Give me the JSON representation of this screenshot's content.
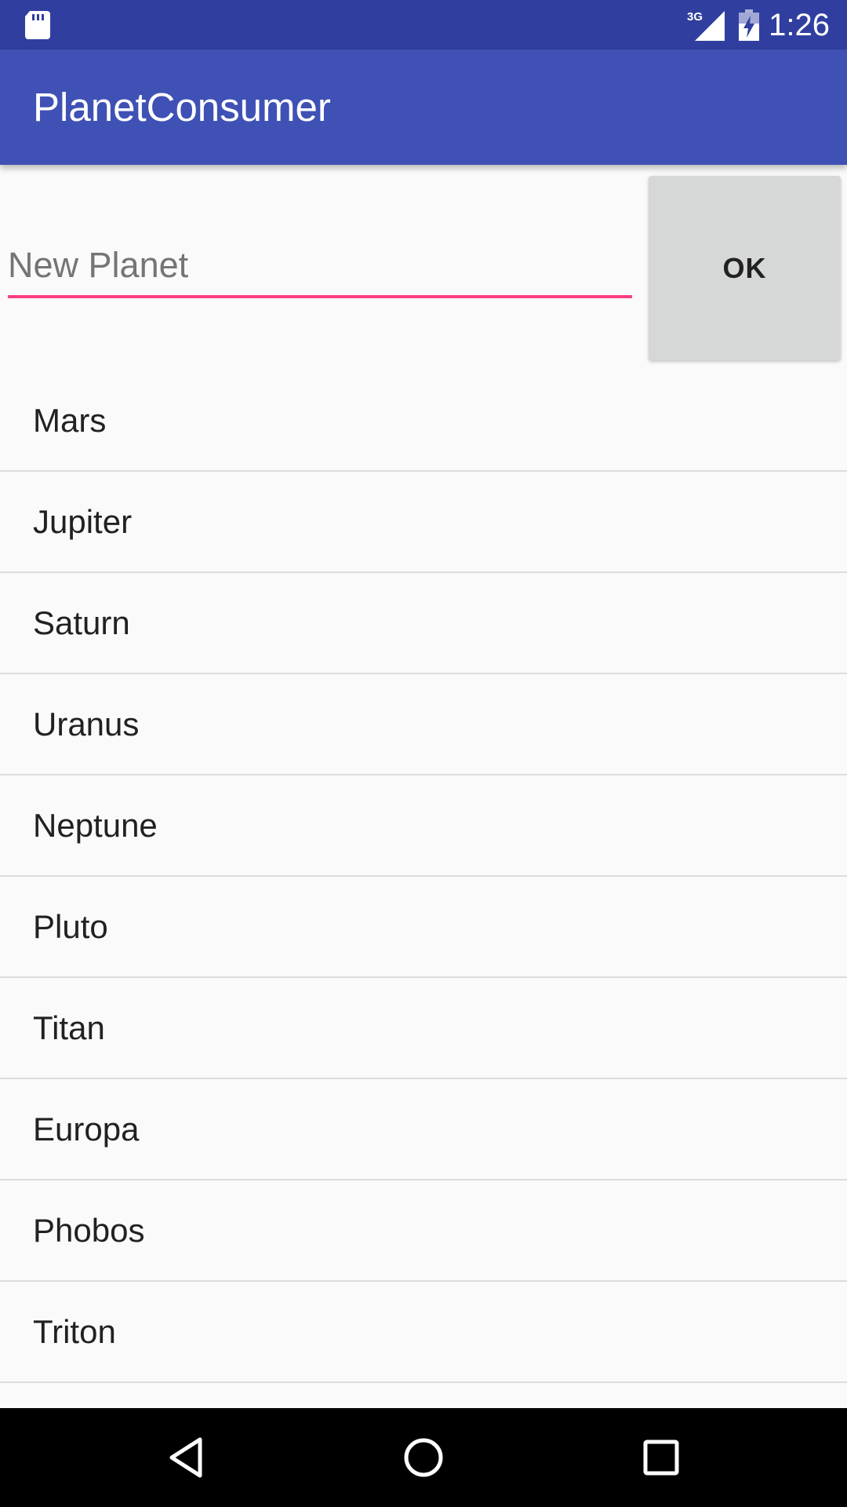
{
  "status_bar": {
    "time": "1:26",
    "network_label": "3G",
    "icons": [
      "sd-card-icon",
      "signal-icon",
      "battery-charging-icon"
    ]
  },
  "app_bar": {
    "title": "PlanetConsumer"
  },
  "input_row": {
    "placeholder": "New Planet",
    "value": "",
    "ok_label": "OK"
  },
  "planets": [
    "Mars",
    "Jupiter",
    "Saturn",
    "Uranus",
    "Neptune",
    "Pluto",
    "Titan",
    "Europa",
    "Phobos",
    "Triton"
  ],
  "nav_bar": {
    "icons": [
      "back-icon",
      "home-icon",
      "recents-icon"
    ]
  },
  "colors": {
    "status_bar": "#303f9f",
    "primary": "#3f51b5",
    "accent": "#ff4081",
    "button": "#d6d7d7",
    "background": "#fafafa"
  }
}
